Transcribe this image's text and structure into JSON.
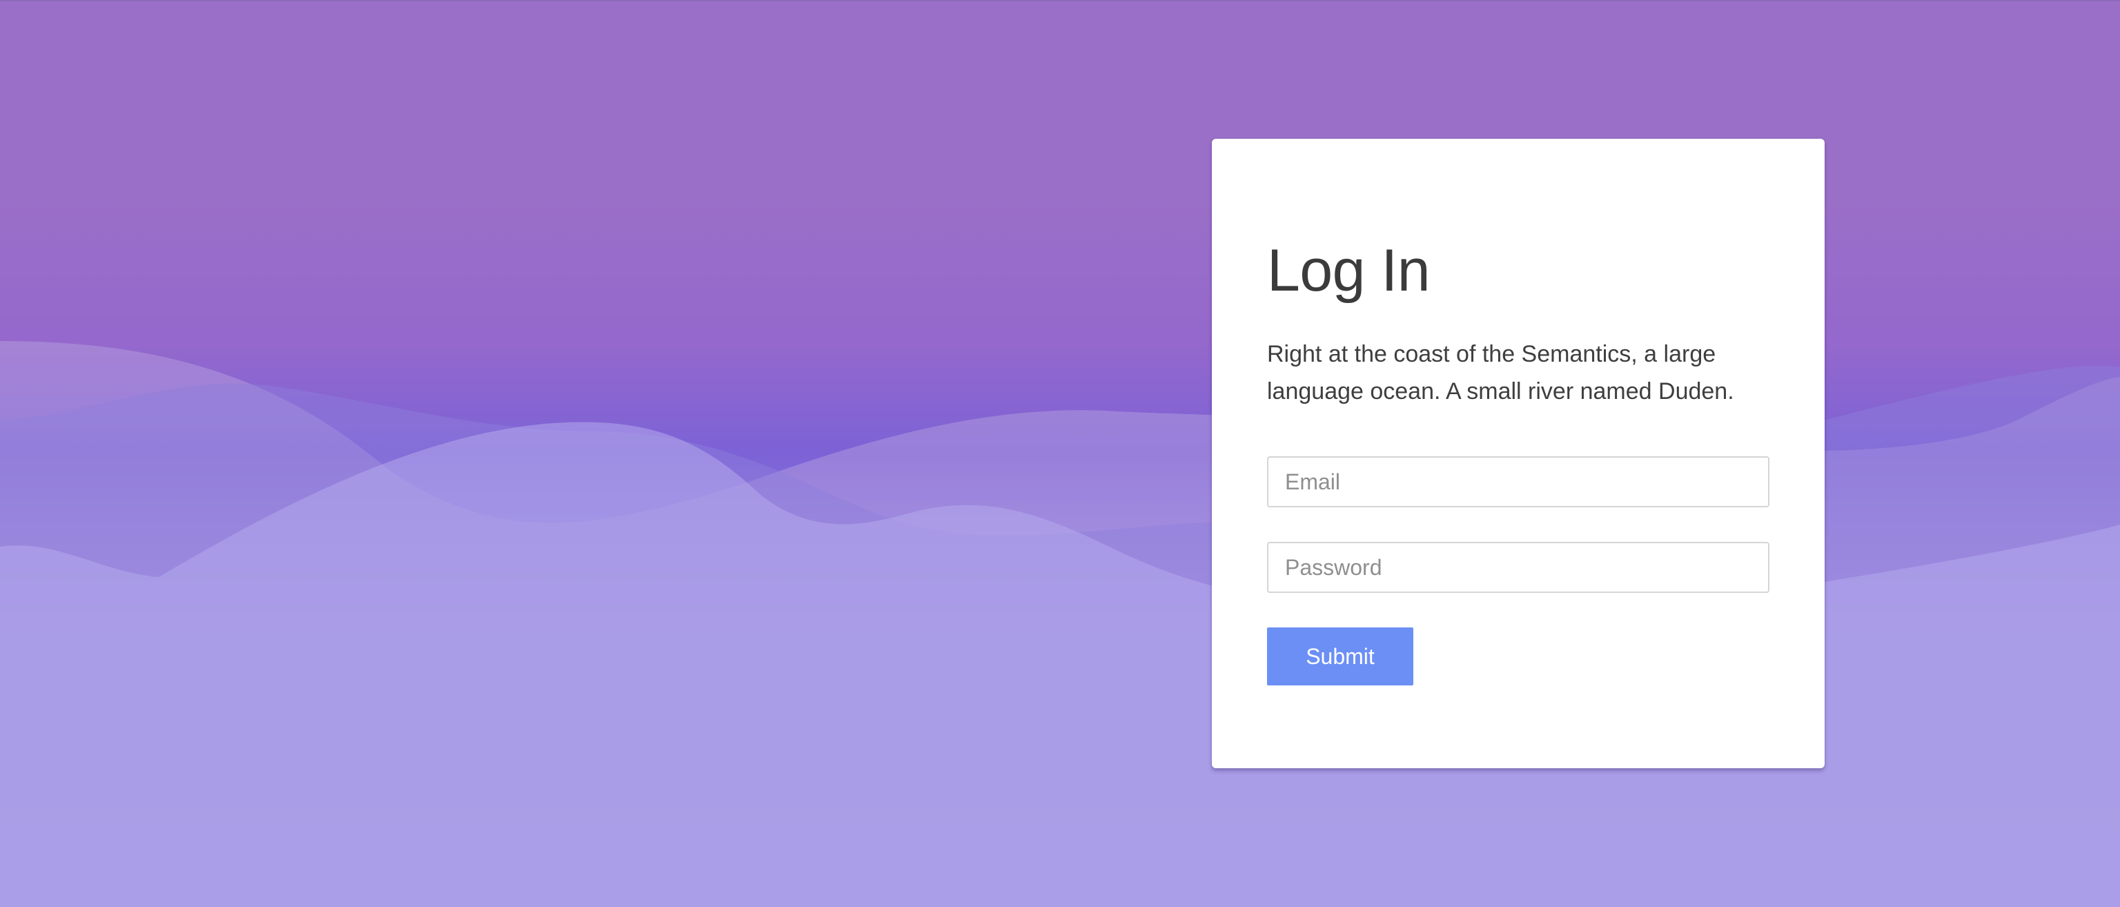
{
  "login": {
    "title": "Log In",
    "description": "Right at the coast of the Semantics, a large language ocean. A small river named Duden.",
    "email_placeholder": "Email",
    "password_placeholder": "Password",
    "submit_label": "Submit"
  },
  "colors": {
    "background_top": "#9a6fc8",
    "background_bottom": "#a19bee",
    "card": "#ffffff",
    "button": "#6b8ff5",
    "title_text": "#3b3b3b"
  }
}
